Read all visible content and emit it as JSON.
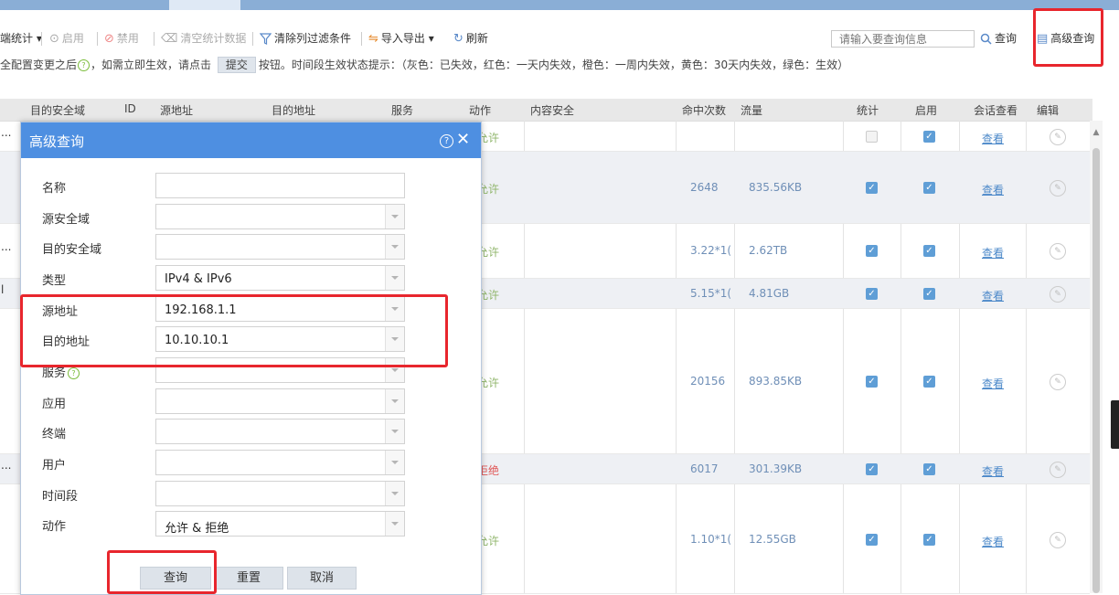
{
  "toolbar": {
    "stats_label": "端统计",
    "enable_label": "启用",
    "disable_label": "禁用",
    "clear_stats_label": "清空统计数据",
    "clear_filter_label": "清除列过滤条件",
    "import_export_label": "导入导出",
    "refresh_label": "刷新",
    "search_placeholder": "请输入要查询信息",
    "search_label": "查询",
    "advanced_label": "高级查询"
  },
  "hint": {
    "before": "全配置变更之后",
    "middle": "，如需立即生效，请点击",
    "submit_label": "提交",
    "after": "按钮。时间段生效状态提示：（灰色：已失效，红色：一天内失效，橙色：一周内失效，黄色：30天内失效，绿色：生效）"
  },
  "table": {
    "headers": [
      "目的安全域",
      "ID",
      "源地址",
      "目的地址",
      "服务",
      "动作",
      "内容安全",
      "命中次数",
      "流量",
      "统计",
      "启用",
      "会话查看",
      "编辑"
    ],
    "view_label": "查看",
    "rows": [
      {
        "lead": "...",
        "action": "允许",
        "action_type": "allow",
        "hits": "",
        "traffic": "",
        "stat": false,
        "enabled": true
      },
      {
        "lead": "",
        "action": "允许",
        "action_type": "allow",
        "hits": "2648",
        "traffic": "835.56KB",
        "stat": true,
        "enabled": true
      },
      {
        "lead": "...",
        "action": "允许",
        "action_type": "allow",
        "hits": "3.22*1(",
        "traffic": "2.62TB",
        "stat": true,
        "enabled": true
      },
      {
        "lead": "l",
        "action": "允许",
        "action_type": "allow",
        "hits": "5.15*1(",
        "traffic": "4.81GB",
        "stat": true,
        "enabled": true
      },
      {
        "lead": "",
        "action": "允许",
        "action_type": "allow",
        "hits": "20156",
        "traffic": "893.85KB",
        "stat": true,
        "enabled": true
      },
      {
        "lead": "...",
        "action": "拒绝",
        "action_type": "deny",
        "hits": "6017",
        "traffic": "301.39KB",
        "stat": true,
        "enabled": true
      },
      {
        "lead": "",
        "action": "允许",
        "action_type": "allow",
        "hits": "1.10*1(",
        "traffic": "12.55GB",
        "stat": true,
        "enabled": true
      }
    ]
  },
  "dialog": {
    "title": "高级查询",
    "fields": [
      {
        "label": "名称",
        "value": "",
        "dropdown": false
      },
      {
        "label": "源安全域",
        "value": "",
        "dropdown": true
      },
      {
        "label": "目的安全域",
        "value": "",
        "dropdown": true
      },
      {
        "label": "类型",
        "value": "IPv4 & IPv6",
        "dropdown": true
      },
      {
        "label": "源地址",
        "value": "192.168.1.1",
        "dropdown": true
      },
      {
        "label": "目的地址",
        "value": "10.10.10.1",
        "dropdown": true
      },
      {
        "label": "服务",
        "value": "",
        "dropdown": true,
        "help": true
      },
      {
        "label": "应用",
        "value": "",
        "dropdown": true
      },
      {
        "label": "终端",
        "value": "",
        "dropdown": true
      },
      {
        "label": "用户",
        "value": "",
        "dropdown": true
      },
      {
        "label": "时间段",
        "value": "",
        "dropdown": true
      },
      {
        "label": "动作",
        "value": "允许 & 拒绝",
        "dropdown": true
      }
    ],
    "query_label": "查询",
    "reset_label": "重置",
    "cancel_label": "取消"
  },
  "icons": [
    "help-icon",
    "close-icon",
    "search-icon",
    "refresh-icon",
    "filter-icon",
    "edit-icon",
    "checkbox-icon"
  ],
  "colors": {
    "dialog_title_bg": "#4e8fe1",
    "highlight": "#e8262d",
    "checkbox": "#5f9ed6",
    "allow_text": "#8fb56a",
    "deny_text": "#e05656",
    "link": "#4b88c9"
  }
}
